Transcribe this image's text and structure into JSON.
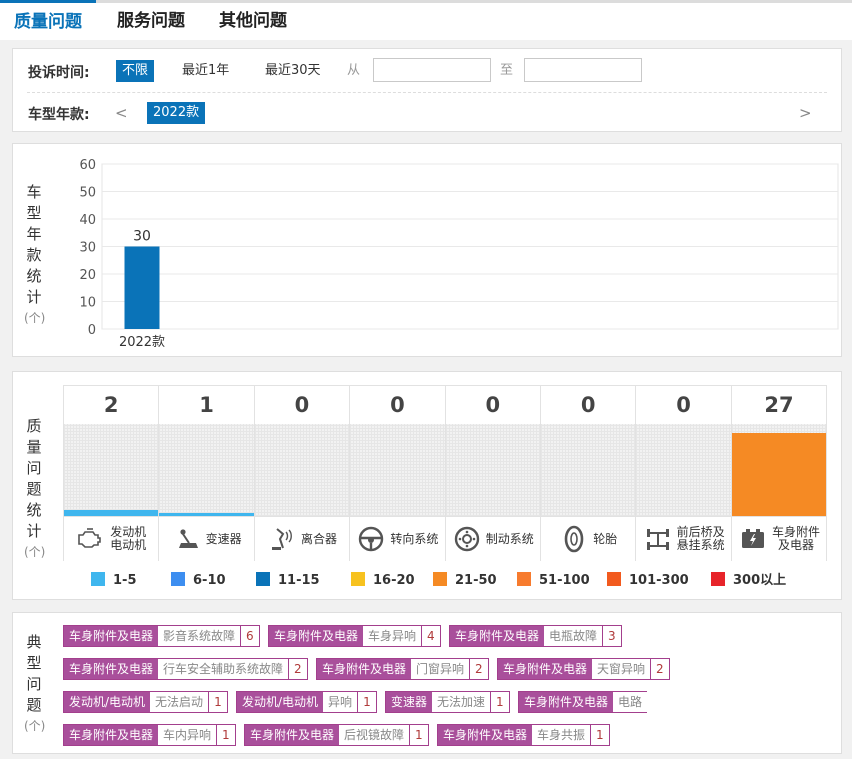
{
  "tabs": [
    {
      "label": "质量问题",
      "active": true
    },
    {
      "label": "服务问题",
      "active": false
    },
    {
      "label": "其他问题",
      "active": false
    }
  ],
  "filters": {
    "time_label": "投诉时间:",
    "time_options": [
      "不限",
      "最近1年",
      "最近30天"
    ],
    "time_selected": "不限",
    "from_label": "从",
    "to_label": "至",
    "from_value": "",
    "to_value": "",
    "year_label": "车型年款:",
    "prev_arrow": "<",
    "next_arrow": ">",
    "years": [
      "2022款"
    ],
    "year_selected": "2022款"
  },
  "year_chart": {
    "side_label_chars": [
      "车",
      "型",
      "年",
      "款",
      "统",
      "计"
    ],
    "unit": "(个)",
    "chart_data": {
      "type": "bar",
      "categories": [
        "2022款"
      ],
      "values": [
        30
      ],
      "data_labels": [
        "30"
      ],
      "ylim": [
        0,
        60
      ],
      "yticks": [
        0,
        10,
        20,
        30,
        40,
        50,
        60
      ],
      "grid": true,
      "bar_color": "#0a73b8"
    }
  },
  "quality_stats": {
    "side_label_chars": [
      "质",
      "量",
      "问",
      "题",
      "统",
      "计"
    ],
    "unit": "(个)",
    "max_value": 30,
    "categories": [
      {
        "name_lines": [
          "发动机",
          "电动机"
        ],
        "count": "2",
        "value": 2,
        "color": "#3fb6ee",
        "icon": "engine-icon"
      },
      {
        "name_lines": [
          "变速器"
        ],
        "count": "1",
        "value": 1,
        "color": "#3fb6ee",
        "icon": "gear-shift-icon"
      },
      {
        "name_lines": [
          "离合器"
        ],
        "count": "0",
        "value": 0,
        "color": "#3fb6ee",
        "icon": "clutch-pedal-icon"
      },
      {
        "name_lines": [
          "转向系统"
        ],
        "count": "0",
        "value": 0,
        "color": "#3fb6ee",
        "icon": "steering-wheel-icon"
      },
      {
        "name_lines": [
          "制动系统"
        ],
        "count": "0",
        "value": 0,
        "color": "#3fb6ee",
        "icon": "brake-disc-icon"
      },
      {
        "name_lines": [
          "轮胎"
        ],
        "count": "0",
        "value": 0,
        "color": "#3fb6ee",
        "icon": "tire-icon"
      },
      {
        "name_lines": [
          "前后桥及",
          "悬挂系统"
        ],
        "count": "0",
        "value": 0,
        "color": "#3fb6ee",
        "icon": "axle-suspension-icon"
      },
      {
        "name_lines": [
          "车身附件",
          "及电器"
        ],
        "count": "27",
        "value": 27,
        "color": "#f58a24",
        "icon": "battery-icon"
      }
    ],
    "legend": [
      {
        "label": "1-5",
        "color": "#3fb6ee"
      },
      {
        "label": "6-10",
        "color": "#3d8ef0"
      },
      {
        "label": "11-15",
        "color": "#0a73b8"
      },
      {
        "label": "16-20",
        "color": "#f7c21f"
      },
      {
        "label": "21-50",
        "color": "#f58a24"
      },
      {
        "label": "51-100",
        "color": "#f77b2e"
      },
      {
        "label": "101-300",
        "color": "#f25a1e"
      },
      {
        "label": "300以上",
        "color": "#e7242a"
      }
    ]
  },
  "typical_issues": {
    "side_label_chars": [
      "典",
      "型",
      "问",
      "题"
    ],
    "unit": "(个)",
    "rows": [
      [
        {
          "category": "车身附件及电器",
          "name": "影音系统故障",
          "count": "6"
        },
        {
          "category": "车身附件及电器",
          "name": "车身异响",
          "count": "4"
        },
        {
          "category": "车身附件及电器",
          "name": "电瓶故障",
          "count": "3"
        }
      ],
      [
        {
          "category": "车身附件及电器",
          "name": "行车安全辅助系统故障",
          "count": "2"
        },
        {
          "category": "车身附件及电器",
          "name": "门窗异响",
          "count": "2"
        },
        {
          "category": "车身附件及电器",
          "name": "天窗异响",
          "count": "2"
        }
      ],
      [
        {
          "category": "发动机/电动机",
          "name": "无法启动",
          "count": "1"
        },
        {
          "category": "发动机/电动机",
          "name": "异响",
          "count": "1"
        },
        {
          "category": "变速器",
          "name": "无法加速",
          "count": "1"
        },
        {
          "category": "车身附件及电器",
          "name": "电路",
          "count": ""
        }
      ],
      [
        {
          "category": "车身附件及电器",
          "name": "车内异响",
          "count": "1"
        },
        {
          "category": "车身附件及电器",
          "name": "后视镜故障",
          "count": "1"
        },
        {
          "category": "车身附件及电器",
          "name": "车身共振",
          "count": "1"
        }
      ]
    ]
  }
}
